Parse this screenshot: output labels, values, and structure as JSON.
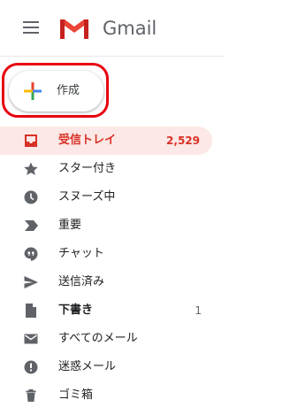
{
  "header": {
    "app_name": "Gmail"
  },
  "compose": {
    "label": "作成"
  },
  "nav": [
    {
      "label": "受信トレイ",
      "count": "2,529",
      "icon": "inbox-icon"
    },
    {
      "label": "スター付き",
      "count": "",
      "icon": "star-icon"
    },
    {
      "label": "スヌーズ中",
      "count": "",
      "icon": "clock-icon"
    },
    {
      "label": "重要",
      "count": "",
      "icon": "important-icon"
    },
    {
      "label": "チャット",
      "count": "",
      "icon": "chat-icon"
    },
    {
      "label": "送信済み",
      "count": "",
      "icon": "send-icon"
    },
    {
      "label": "下書き",
      "count": "1",
      "icon": "draft-icon"
    },
    {
      "label": "すべてのメール",
      "count": "",
      "icon": "mail-icon"
    },
    {
      "label": "迷惑メール",
      "count": "",
      "icon": "spam-icon"
    },
    {
      "label": "ゴミ箱",
      "count": "",
      "icon": "trash-icon"
    }
  ],
  "colors": {
    "active_bg": "#fce8e6",
    "active_text": "#d93025",
    "highlight": "#e8000f",
    "icon": "#5f6368"
  }
}
